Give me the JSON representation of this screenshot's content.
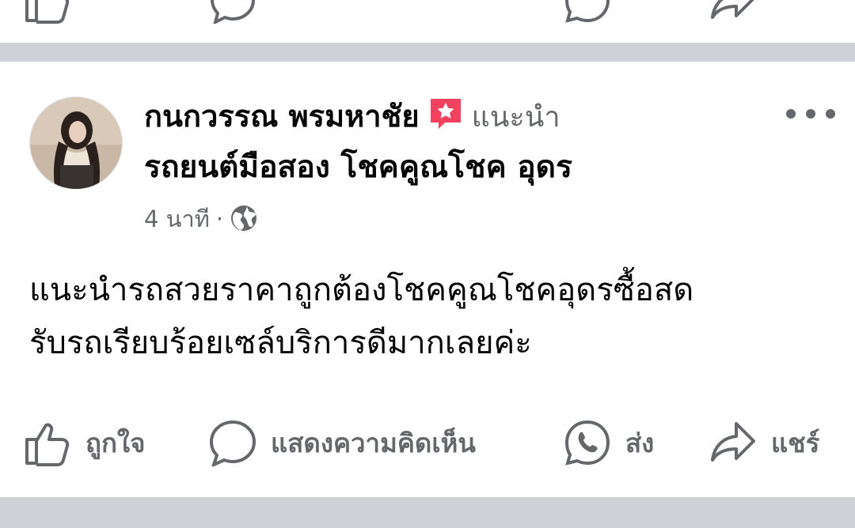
{
  "post": {
    "author_name": "กนกวรรณ พรมหาชัย",
    "recommends_label": "แนะนำ",
    "page_name": "รถยนต์มือสอง โชคคูณโชค อุดร",
    "timestamp": "4 นาที",
    "separator": "·",
    "privacy_icon": "globe-icon",
    "text_lines": [
      "แนะนำรถสวยราคาถูกต้องโชคคูณโชคอุดรซื้อสด",
      "รับรถเรียบร้อยเซล์บริการดีมากเลยค่ะ"
    ]
  },
  "actions": {
    "like_label": "ถูกใจ",
    "comment_label": "แสดงความคิดเห็น",
    "send_label": "ส่ง",
    "share_label": "แชร์"
  },
  "colors": {
    "divider": "#d0d1d6",
    "secondary_text": "#65676b",
    "primary_text": "#050505",
    "recommend_badge": "#f3425f"
  }
}
